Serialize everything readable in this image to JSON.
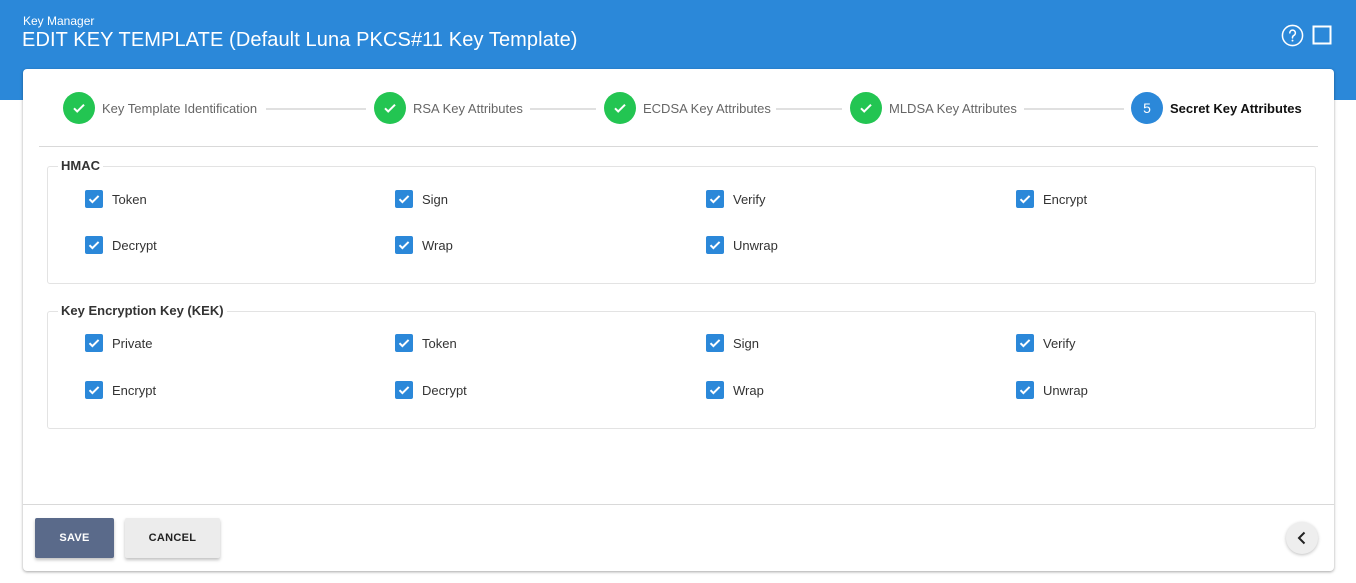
{
  "header": {
    "app_name": "Key Manager",
    "title": "EDIT KEY TEMPLATE (Default Luna PKCS#11 Key Template)",
    "help_icon": "help-circle-icon",
    "window_icon": "square-icon"
  },
  "stepper": {
    "steps": [
      {
        "label": "Key Template Identification",
        "state": "done"
      },
      {
        "label": "RSA Key Attributes",
        "state": "done"
      },
      {
        "label": "ECDSA Key Attributes",
        "state": "done"
      },
      {
        "label": "MLDSA Key Attributes",
        "state": "done"
      },
      {
        "label": "Secret Key Attributes",
        "state": "active",
        "number": "5"
      }
    ]
  },
  "sections": {
    "hmac": {
      "title": "HMAC",
      "options": [
        {
          "label": "Token",
          "checked": true
        },
        {
          "label": "Sign",
          "checked": true
        },
        {
          "label": "Verify",
          "checked": true
        },
        {
          "label": "Encrypt",
          "checked": true
        },
        {
          "label": "Decrypt",
          "checked": true
        },
        {
          "label": "Wrap",
          "checked": true
        },
        {
          "label": "Unwrap",
          "checked": true
        }
      ]
    },
    "kek": {
      "title": "Key Encryption Key (KEK)",
      "options": [
        {
          "label": "Private",
          "checked": true
        },
        {
          "label": "Token",
          "checked": true
        },
        {
          "label": "Sign",
          "checked": true
        },
        {
          "label": "Verify",
          "checked": true
        },
        {
          "label": "Encrypt",
          "checked": true
        },
        {
          "label": "Decrypt",
          "checked": true
        },
        {
          "label": "Wrap",
          "checked": true
        },
        {
          "label": "Unwrap",
          "checked": true
        }
      ]
    }
  },
  "footer": {
    "save_label": "SAVE",
    "cancel_label": "CANCEL",
    "collapse_icon": "chevron-left-icon"
  },
  "colors": {
    "header_bg": "#2b88d9",
    "step_done": "#23c552",
    "step_active": "#2b88d9",
    "checkbox": "#2b88d9",
    "save_button": "#5a6a8a"
  }
}
